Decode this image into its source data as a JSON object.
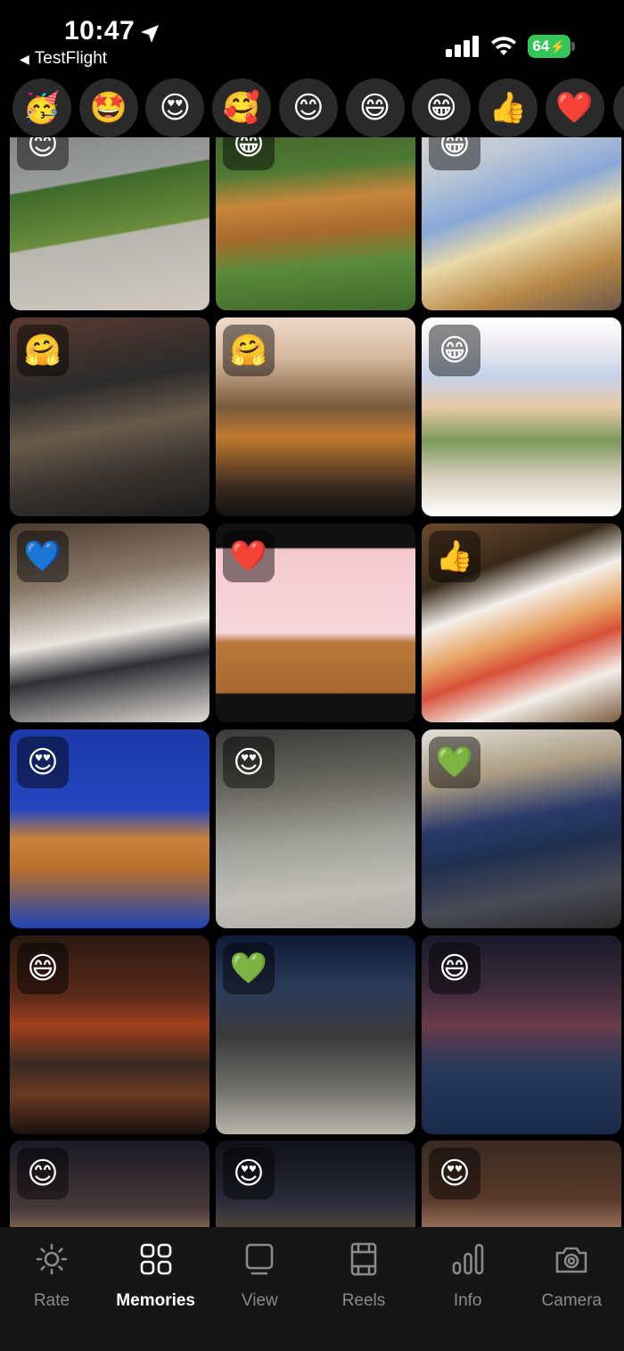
{
  "status_bar": {
    "time": "10:47",
    "back_app": "TestFlight",
    "battery": "64"
  },
  "reactions": [
    {
      "emoji": "🥳",
      "name": "partying-face"
    },
    {
      "emoji": "🤩",
      "name": "star-struck"
    },
    {
      "emoji": "😍",
      "name": "heart-eyes"
    },
    {
      "emoji": "🥰",
      "name": "smiling-hearts"
    },
    {
      "emoji": "😊",
      "name": "smiling-face"
    },
    {
      "emoji": "😄",
      "name": "grinning-face"
    },
    {
      "emoji": "😁",
      "name": "beaming-face"
    },
    {
      "emoji": "👍",
      "name": "thumbs-up"
    },
    {
      "emoji": "❤️",
      "name": "red-heart"
    }
  ],
  "photos": [
    {
      "badge": "😊",
      "desc": "dog on sidewalk lawn"
    },
    {
      "badge": "😁",
      "desc": "golden retriever on grass"
    },
    {
      "badge": "😁",
      "desc": "ironing board and dog"
    },
    {
      "badge": "🤗",
      "desc": "chihuahua by fireplace"
    },
    {
      "badge": "🤗",
      "desc": "tiktok golden retriever"
    },
    {
      "badge": "😁",
      "desc": "snapchat profile"
    },
    {
      "badge": "💙",
      "desc": "woman holding white dog"
    },
    {
      "badge": "❤️",
      "desc": "dog diary cartoon"
    },
    {
      "badge": "👍",
      "desc": "pizza slice on plate"
    },
    {
      "badge": "😍",
      "desc": "museum figures on blue"
    },
    {
      "badge": "😍",
      "desc": "city sidewalk"
    },
    {
      "badge": "💚",
      "desc": "exhibit visitors"
    },
    {
      "badge": "😄",
      "desc": "jazz bar"
    },
    {
      "badge": "💚",
      "desc": "street at night"
    },
    {
      "badge": "😄",
      "desc": "night crowd"
    },
    {
      "badge": "😊",
      "desc": "times square crowd"
    },
    {
      "badge": "😍",
      "desc": "night street crowd"
    },
    {
      "badge": "😍",
      "desc": "selfie two men"
    }
  ],
  "tabs": [
    {
      "label": "Rate",
      "icon": "sun-icon",
      "active": false
    },
    {
      "label": "Memories",
      "icon": "grid-icon",
      "active": true
    },
    {
      "label": "View",
      "icon": "frame-icon",
      "active": false
    },
    {
      "label": "Reels",
      "icon": "film-icon",
      "active": false
    },
    {
      "label": "Info",
      "icon": "bar-chart-icon",
      "active": false
    },
    {
      "label": "Camera",
      "icon": "camera-icon",
      "active": false
    }
  ]
}
